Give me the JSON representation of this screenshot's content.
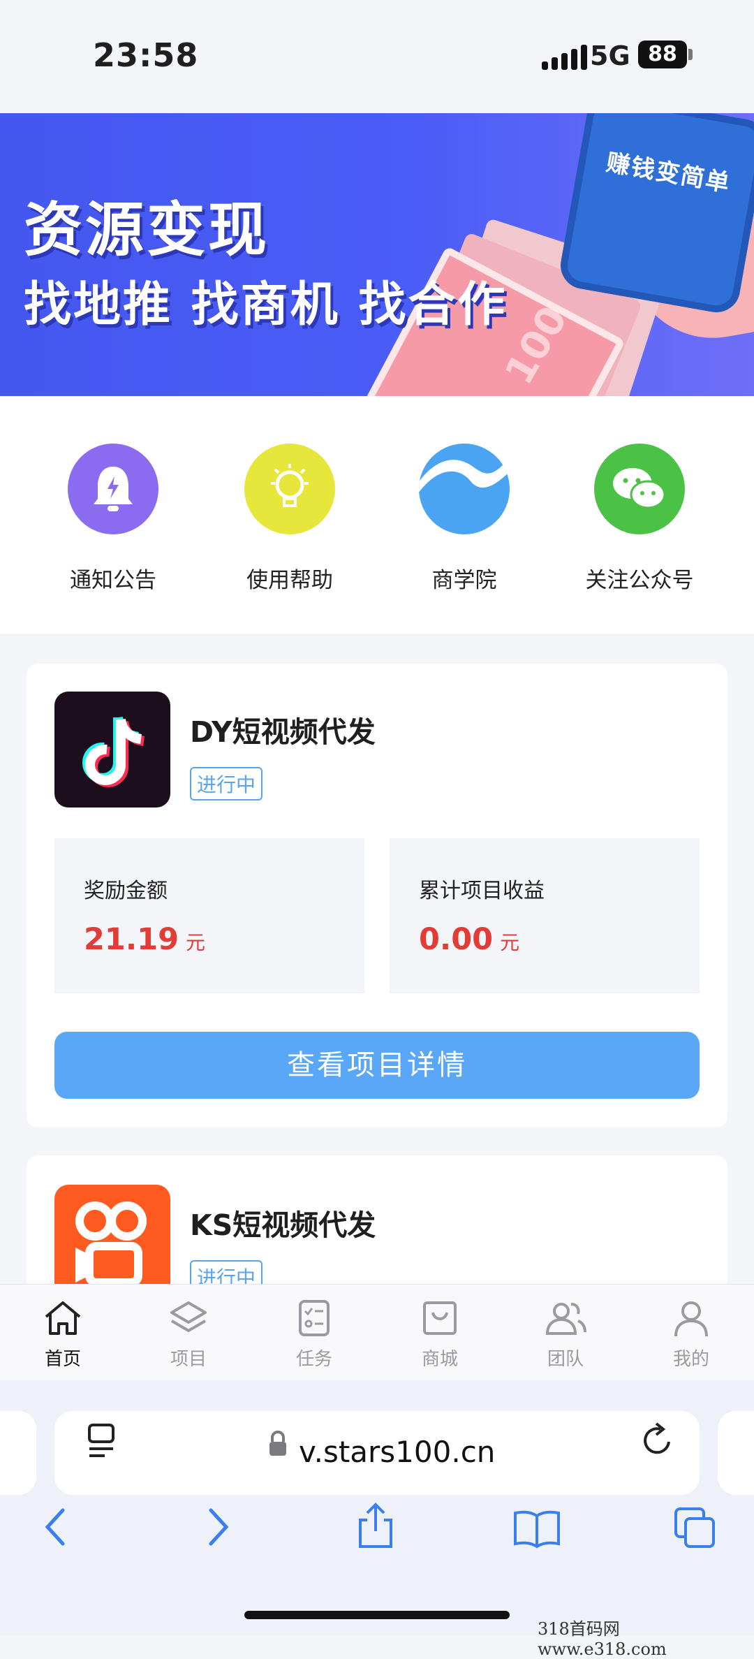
{
  "status": {
    "time": "23:58",
    "network": "5G",
    "battery": "88"
  },
  "banner": {
    "headline": "资源变现",
    "subline": "找地推 找商机 找合作",
    "phone_text": "赚钱变简单",
    "bill_text": "100"
  },
  "quick_links": [
    {
      "label": "通知公告",
      "icon": "bell-icon",
      "color": "#8b6cf1"
    },
    {
      "label": "使用帮助",
      "icon": "lightbulb-icon",
      "color": "#e7e63b"
    },
    {
      "label": "商学院",
      "icon": "wave-icon",
      "color": "#4aa3f3"
    },
    {
      "label": "关注公众号",
      "icon": "wechat-icon",
      "color": "#4bc145"
    }
  ],
  "projects": [
    {
      "name": "DY短视频代发",
      "status": "进行中",
      "reward_label": "奖励金额",
      "reward_value": "21.19",
      "reward_unit": "元",
      "total_label": "累计项目收益",
      "total_value": "0.00",
      "total_unit": "元",
      "button": "查看项目详情"
    },
    {
      "name": "KS短视频代发",
      "status": "进行中"
    }
  ],
  "tabbar": [
    {
      "label": "首页",
      "icon": "home-icon",
      "active": true
    },
    {
      "label": "项目",
      "icon": "layers-icon",
      "active": false
    },
    {
      "label": "任务",
      "icon": "checklist-icon",
      "active": false
    },
    {
      "label": "商城",
      "icon": "shopping-bag-icon",
      "active": false
    },
    {
      "label": "团队",
      "icon": "team-icon",
      "active": false
    },
    {
      "label": "我的",
      "icon": "profile-icon",
      "active": false
    }
  ],
  "browser": {
    "url": "v.stars100.cn"
  },
  "watermark": "318首码网  www.e318.com"
}
